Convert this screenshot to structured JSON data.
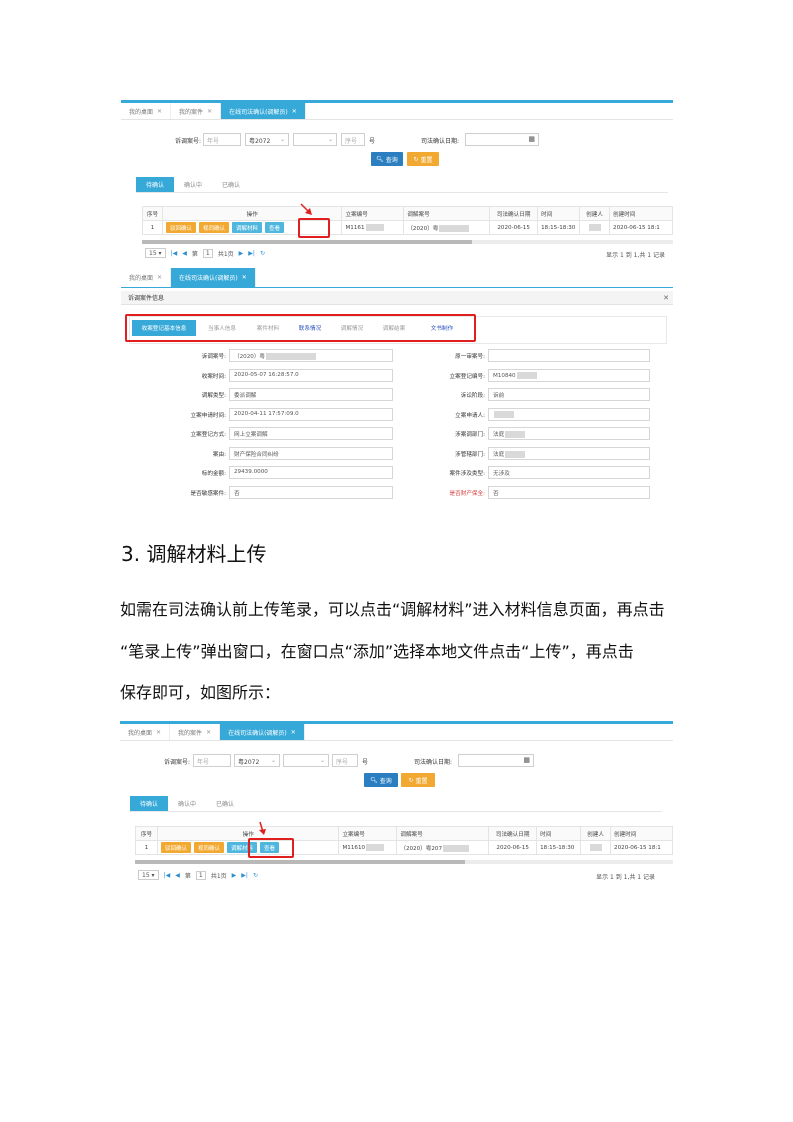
{
  "shot1": {
    "tabs": [
      {
        "label": "我的桌面",
        "close": "✕"
      },
      {
        "label": "我的案件",
        "close": "✕"
      },
      {
        "label": "在线司法确认(调解员)",
        "close": "✕"
      }
    ],
    "filter": {
      "case_no_label": "诉调案号:",
      "year_placeholder": "年号",
      "prefix_value": "粤2072",
      "seq_placeholder": "序号",
      "hao": "号",
      "date_label": "司法确认日期:"
    },
    "buttons": {
      "search": "查询",
      "reset": "重置"
    },
    "subtabs": [
      "待确认",
      "确认中",
      "已确认"
    ],
    "columns": [
      "序号",
      "操作",
      "立案编号",
      "调解案号",
      "司法确认日期",
      "时间",
      "创建人",
      "创建时间"
    ],
    "row": {
      "no": "1",
      "ops": [
        "驳回确认",
        "视同确认",
        "调解材料",
        "查看"
      ],
      "case_id": "M1161",
      "mediation_no": "（2020）粤",
      "date": "2020-06-15",
      "time": "18:15-18:30",
      "created": "2020-06-15 18:1"
    },
    "pager": {
      "size": "15",
      "page_prefix": "第",
      "page": "1",
      "page_suffix": "共1页",
      "info": "显示 1 到 1,共 1 记录"
    }
  },
  "shot2": {
    "tabs": [
      {
        "label": "我的桌面",
        "close": "✕"
      },
      {
        "label": "在线司法确认(调解员)",
        "close": "✕"
      }
    ],
    "title": "诉调案件信息",
    "close": "✕",
    "tabs_inner": [
      "收案登记基本信息",
      "当事人信息",
      "案件材料",
      "联系情况",
      "调解情况",
      "调解结果",
      "文书制作"
    ],
    "left_fields": [
      {
        "label": "诉调案号:",
        "value": "（2020）粤"
      },
      {
        "label": "收案时间:",
        "value": "2020-05-07 16:28:57.0"
      },
      {
        "label": "调解类型:",
        "value": "委派调解"
      },
      {
        "label": "立案申请时间:",
        "value": "2020-04-11 17:57:09.0"
      },
      {
        "label": "立案登记方式:",
        "value": "网上立案调解"
      },
      {
        "label": "案由:",
        "value": "财产保险合同纠纷"
      },
      {
        "label": "标的金额:",
        "value": "29439.0000"
      },
      {
        "label": "是否敏感案件:",
        "value": "否"
      }
    ],
    "right_fields": [
      {
        "label": "原一审案号:",
        "value": ""
      },
      {
        "label": "立案登记编号:",
        "value": "M10840"
      },
      {
        "label": "诉讼阶段:",
        "value": "诉前"
      },
      {
        "label": "立案申请人:",
        "value": ""
      },
      {
        "label": "涉案调部门:",
        "value": "法庭"
      },
      {
        "label": "涉管辖部门:",
        "value": "法庭"
      },
      {
        "label": "案件涉及类型:",
        "value": "无涉及"
      },
      {
        "label": "是否财产保全:",
        "value": "否",
        "red": true
      }
    ]
  },
  "section": {
    "heading": "3.  调解材料上传",
    "para_lines": [
      "如需在司法确认前上传笔录，可以点击“调解材料”进入材料信息页面，再点击",
      "“笔录上传”弹出窗口，在窗口点“添加”选择本地文件点击“上传”，再点击",
      "保存即可，如图所示："
    ]
  },
  "shot3": {
    "tabs": [
      {
        "label": "我的桌面",
        "close": "✕"
      },
      {
        "label": "我的案件",
        "close": "✕"
      },
      {
        "label": "在线司法确认(调解员)",
        "close": "✕"
      }
    ],
    "filter": {
      "case_no_label": "诉调案号:",
      "year_placeholder": "年号",
      "prefix_value": "粤2072",
      "seq_placeholder": "序号",
      "hao": "号",
      "date_label": "司法确认日期:"
    },
    "buttons": {
      "search": "查询",
      "reset": "重置"
    },
    "subtabs": [
      "待确认",
      "确认中",
      "已确认"
    ],
    "columns": [
      "序号",
      "操作",
      "立案编号",
      "调解案号",
      "司法确认日期",
      "时间",
      "创建人",
      "创建时间"
    ],
    "row": {
      "no": "1",
      "ops": [
        "驳回确认",
        "视同确认",
        "调解材料",
        "查看"
      ],
      "case_id": "M11610",
      "mediation_no": "（2020）粤207",
      "date": "2020-06-15",
      "time": "18:15-18:30",
      "created": "2020-06-15 18:1"
    },
    "pager": {
      "size": "15",
      "page_prefix": "第",
      "page": "1",
      "page_suffix": "共1页",
      "info": "显示 1 到 1,共 1 记录"
    }
  }
}
